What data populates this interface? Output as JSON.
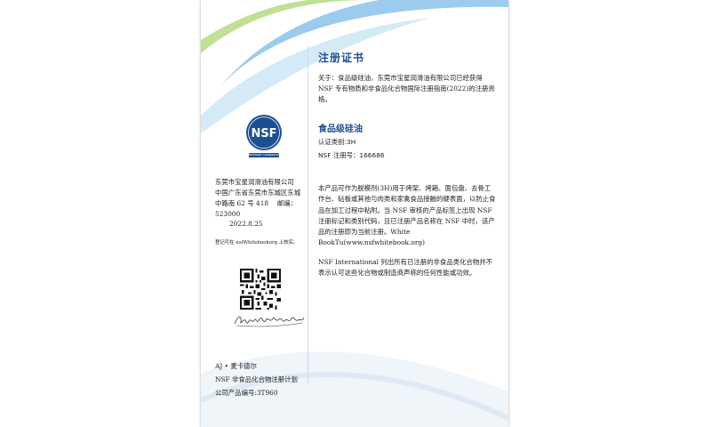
{
  "certificate": {
    "title": "注册证书",
    "about_text": "关于：食品级硅油，东莞市宝星润滑油有限公司已经获得 NSF 专有物质和非食品化合物国际注册指南(2022)的注册资格。",
    "product_name": "食品级硅油",
    "category": "认证类别:3H",
    "registration_no": "NSF 注册号：166686",
    "description": "本产品可作为脱模剂(3H)用于烤架、烤箱、面包盘、去骨工作台、砧板或其他与肉类和家禽食品接触的硬表面，以防止食品在加工过程中粘附。当 NSF 审核的产品标签上出现 NSF 注册标记和类别代码，且已注册产品名称在 NSF 中时，该产品的注册即为当前注册。White BookTu(www.nsfwhitebook.org)",
    "disclaimer": "NSF International 列出所有已注册的非食品类化合物并不表示认可这些化合物或制造商声称的任何性能或功效。"
  },
  "sidebar": {
    "logo_text": "NSF",
    "logo_subtext": "Nonfood Compounds",
    "company_lines": [
      "东莞市宝星润滑油有限公司",
      "中国广东省东莞市东城区东城",
      "中路南 62 号 418　 邮编：",
      "523000"
    ],
    "date": "2022.8.25",
    "verify_text": "登记可在 nsfWhitebookorg 上核实。",
    "signer_name": "AJ • 麦卡德尔",
    "program": "NSF 非食品化合物注册计划",
    "company_no": "公司产品编号:3T960"
  },
  "colors": {
    "brand_blue": "#1d4e8f",
    "swoosh_green": "#8cc63f",
    "swoosh_blue": "#4aa3df"
  }
}
